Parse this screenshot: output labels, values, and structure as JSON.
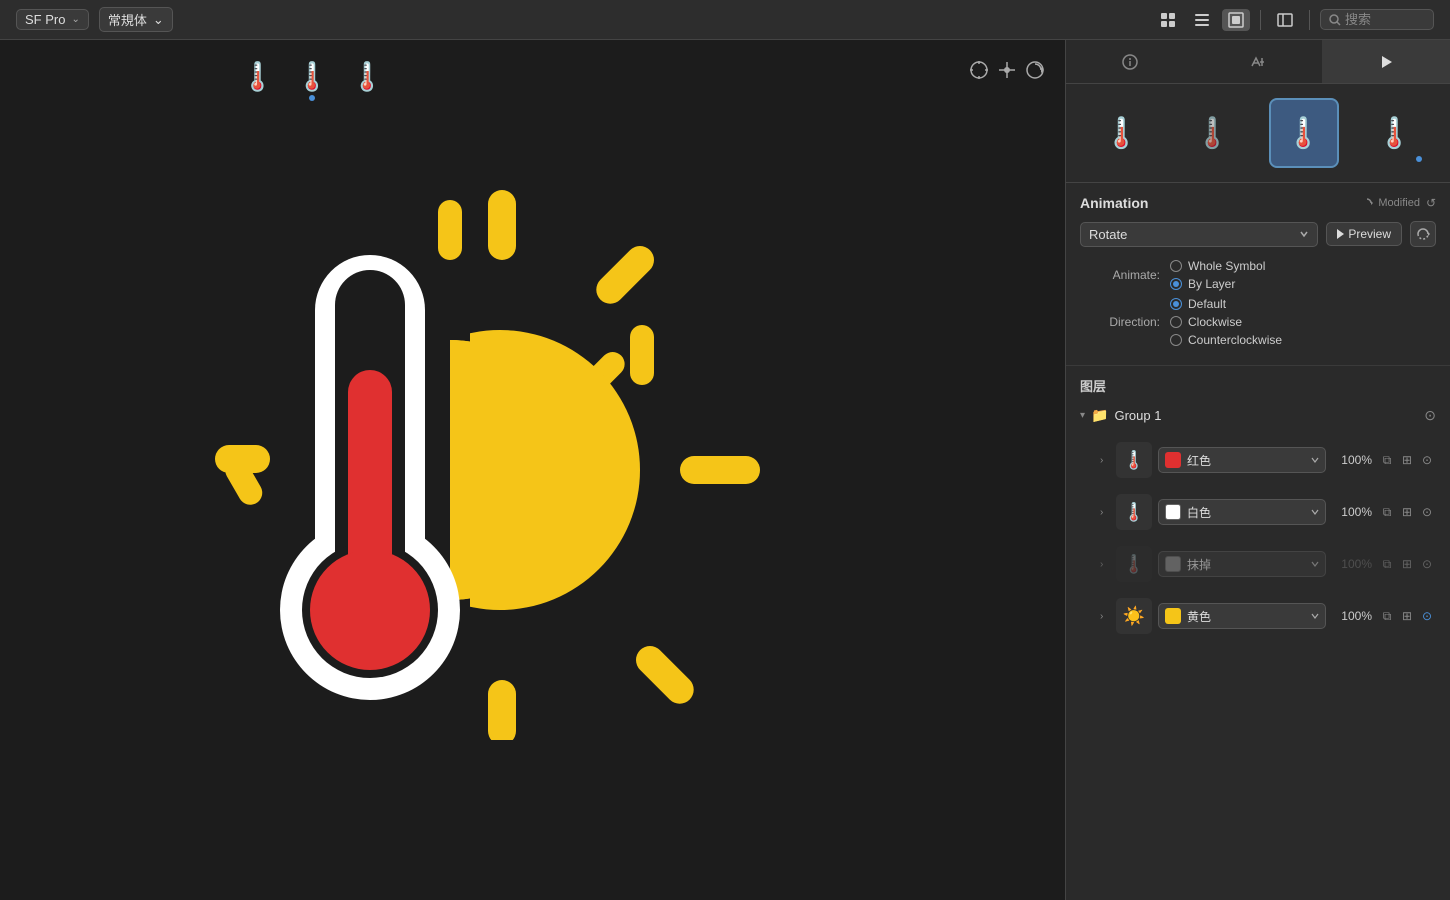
{
  "toolbar": {
    "font_name": "SF Pro",
    "font_style": "常規体",
    "search_placeholder": "搜索",
    "view_icons": [
      "grid",
      "list",
      "artboard"
    ],
    "sidebar_icon": "sidebar",
    "search_icon": "search"
  },
  "canvas": {
    "variants": [
      "🌡️",
      "🌡️",
      "🌡️"
    ],
    "controls": [
      "crosshair",
      "pin",
      "rotate"
    ]
  },
  "panel": {
    "tabs": [
      {
        "id": "info",
        "icon": "ℹ",
        "active": false
      },
      {
        "id": "attr",
        "icon": "✏",
        "active": false
      },
      {
        "id": "play",
        "icon": "▶",
        "active": true
      }
    ],
    "symbol_variants": [
      {
        "emoji": "🌡️",
        "selected": false,
        "dot": false
      },
      {
        "emoji": "🌡️",
        "selected": false,
        "dot": false
      },
      {
        "emoji": "🌡️",
        "selected": true,
        "dot": false
      },
      {
        "emoji": "🌡️",
        "selected": false,
        "dot": true
      }
    ],
    "animation": {
      "section_title": "Animation",
      "modified_label": "Modified",
      "reset_label": "↺",
      "type": "Rotate",
      "preview_label": "Preview",
      "sync_label": "⇄",
      "animate_label": "Animate:",
      "whole_symbol_label": "Whole Symbol",
      "by_layer_label": "By Layer",
      "direction_label": "Direction:",
      "default_label": "Default",
      "clockwise_label": "Clockwise",
      "counterclockwise_label": "Counterclockwise",
      "animate_checked": "by_layer",
      "direction_checked": "default"
    },
    "layers": {
      "section_title": "图层",
      "group_name": "Group 1",
      "items": [
        {
          "name": "layer-red",
          "thumb_emoji": "🌡️",
          "color_label": "红色",
          "color_hex": "#e03030",
          "opacity": "100%",
          "muted": false
        },
        {
          "name": "layer-white",
          "thumb_emoji": "🌡️",
          "color_label": "白色",
          "color_hex": "#ffffff",
          "opacity": "100%",
          "muted": false
        },
        {
          "name": "layer-erase",
          "thumb_emoji": "🌡️",
          "color_label": "抹掉",
          "color_hex": "#888888",
          "opacity": "100%",
          "muted": true
        },
        {
          "name": "layer-yellow",
          "thumb_emoji": "☀️",
          "color_label": "黄色",
          "color_hex": "#f5c518",
          "opacity": "100%",
          "muted": false
        }
      ]
    }
  }
}
